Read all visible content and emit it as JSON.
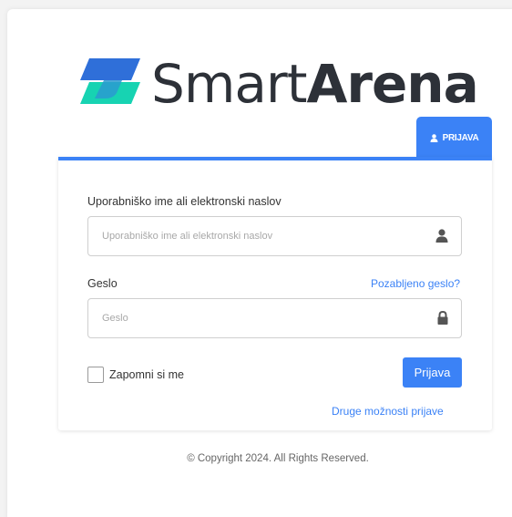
{
  "brand": {
    "name_light": "Smart",
    "name_bold": "Arena",
    "colors": {
      "logo_blue": "#2f6fd9",
      "logo_teal": "#17d3b2",
      "text_dark": "#2d3138"
    }
  },
  "tab": {
    "icon": "user-icon",
    "label": "PRIJAVA"
  },
  "form": {
    "username": {
      "label": "Uporabniško ime ali elektronski naslov",
      "placeholder": "Uporabniško ime ali elektronski naslov",
      "value": "",
      "icon": "user-icon"
    },
    "password": {
      "label": "Geslo",
      "placeholder": "Geslo",
      "value": "",
      "icon": "lock-icon",
      "forgot_link": "Pozabljeno geslo?"
    },
    "remember_label": "Zapomni si me",
    "submit_label": "Prijava",
    "other_options_link": "Druge možnosti prijave"
  },
  "footer": {
    "copyright": "© Copyright 2024. All Rights Reserved."
  },
  "accent": "#3b82f6"
}
